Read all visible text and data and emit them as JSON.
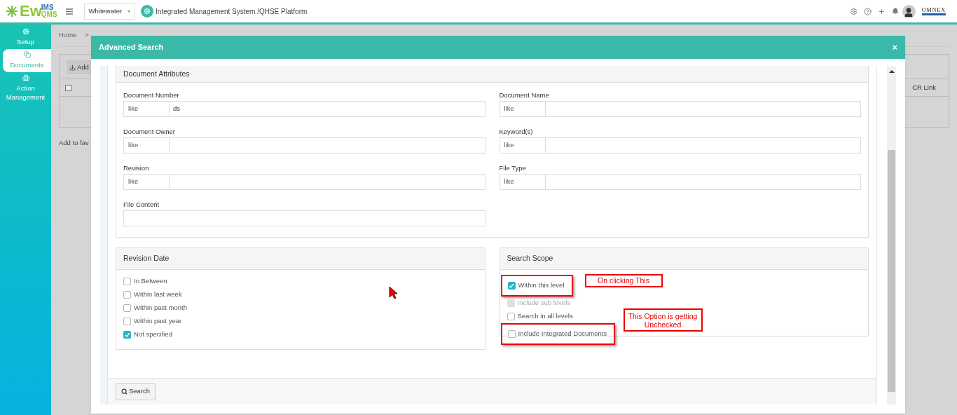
{
  "logo": {
    "main": "Ew",
    "top": "IMS",
    "bottom": "QMS"
  },
  "header": {
    "site": "Whitewater",
    "title": "Integrated Management System /QHSE Platform",
    "brand": "OMNEX"
  },
  "sidebar": [
    {
      "label": "Setup",
      "selected": false
    },
    {
      "label": "Documents",
      "selected": true
    },
    {
      "label": "Action Management",
      "selected": false
    }
  ],
  "background": {
    "checked": false,
    "breadcrumb": "Home",
    "separator": ">",
    "add_button": "Add",
    "column": "CR Link",
    "favorites": "Add to fav"
  },
  "dialog": {
    "title": "Advanced Search",
    "close": "×",
    "attributes": {
      "title": "Document Attributes",
      "fields": [
        {
          "label": "Document Number",
          "operator": "like",
          "value": "ds"
        },
        {
          "label": "Document Name",
          "operator": "like"
        },
        {
          "label": "Document Owner",
          "operator": "like"
        },
        {
          "label": "Keyword(s)",
          "operator": "like"
        },
        {
          "label": "Revision",
          "operator": "like"
        },
        {
          "label": "File Type",
          "operator": "like"
        },
        {
          "label": "File Content"
        }
      ]
    },
    "revision_date": {
      "title": "Revision Date",
      "options": [
        {
          "label": "In Between",
          "checked": false
        },
        {
          "label": "Within last week",
          "checked": false
        },
        {
          "label": "Within past month",
          "checked": false
        },
        {
          "label": "Within past year",
          "checked": false
        },
        {
          "label": "Not specified",
          "checked": true
        }
      ]
    },
    "search_scope": {
      "title": "Search Scope",
      "options": [
        {
          "label": "Within this level",
          "checked": true,
          "disabled": false,
          "highlighted": true
        },
        {
          "label": "Include sub levels",
          "checked": false,
          "disabled": true,
          "highlighted": false
        },
        {
          "label": "Search in all levels",
          "checked": false,
          "disabled": false,
          "highlighted": false
        },
        {
          "label": "Include Integrated Documents",
          "checked": false,
          "disabled": false,
          "highlighted": true
        }
      ]
    },
    "callouts": [
      "On clicking This",
      "This Option is getting Unchecked"
    ],
    "search_button": "Search"
  }
}
